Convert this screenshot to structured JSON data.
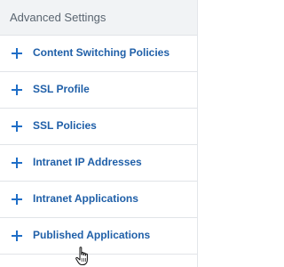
{
  "panel": {
    "title": "Advanced Settings"
  },
  "items": [
    {
      "label": "Content Switching Policies",
      "icon": "plus-icon"
    },
    {
      "label": "SSL Profile",
      "icon": "plus-icon"
    },
    {
      "label": "SSL Policies",
      "icon": "plus-icon"
    },
    {
      "label": "Intranet IP Addresses",
      "icon": "plus-icon"
    },
    {
      "label": "Intranet Applications",
      "icon": "plus-icon"
    },
    {
      "label": "Published Applications",
      "icon": "plus-icon"
    }
  ],
  "colors": {
    "accent": "#1f6ec7",
    "label": "#1f5fa8",
    "header_bg": "#f1f3f5",
    "divider": "#e1e4e8"
  },
  "cursor": {
    "icon": "hand-pointer-icon"
  }
}
